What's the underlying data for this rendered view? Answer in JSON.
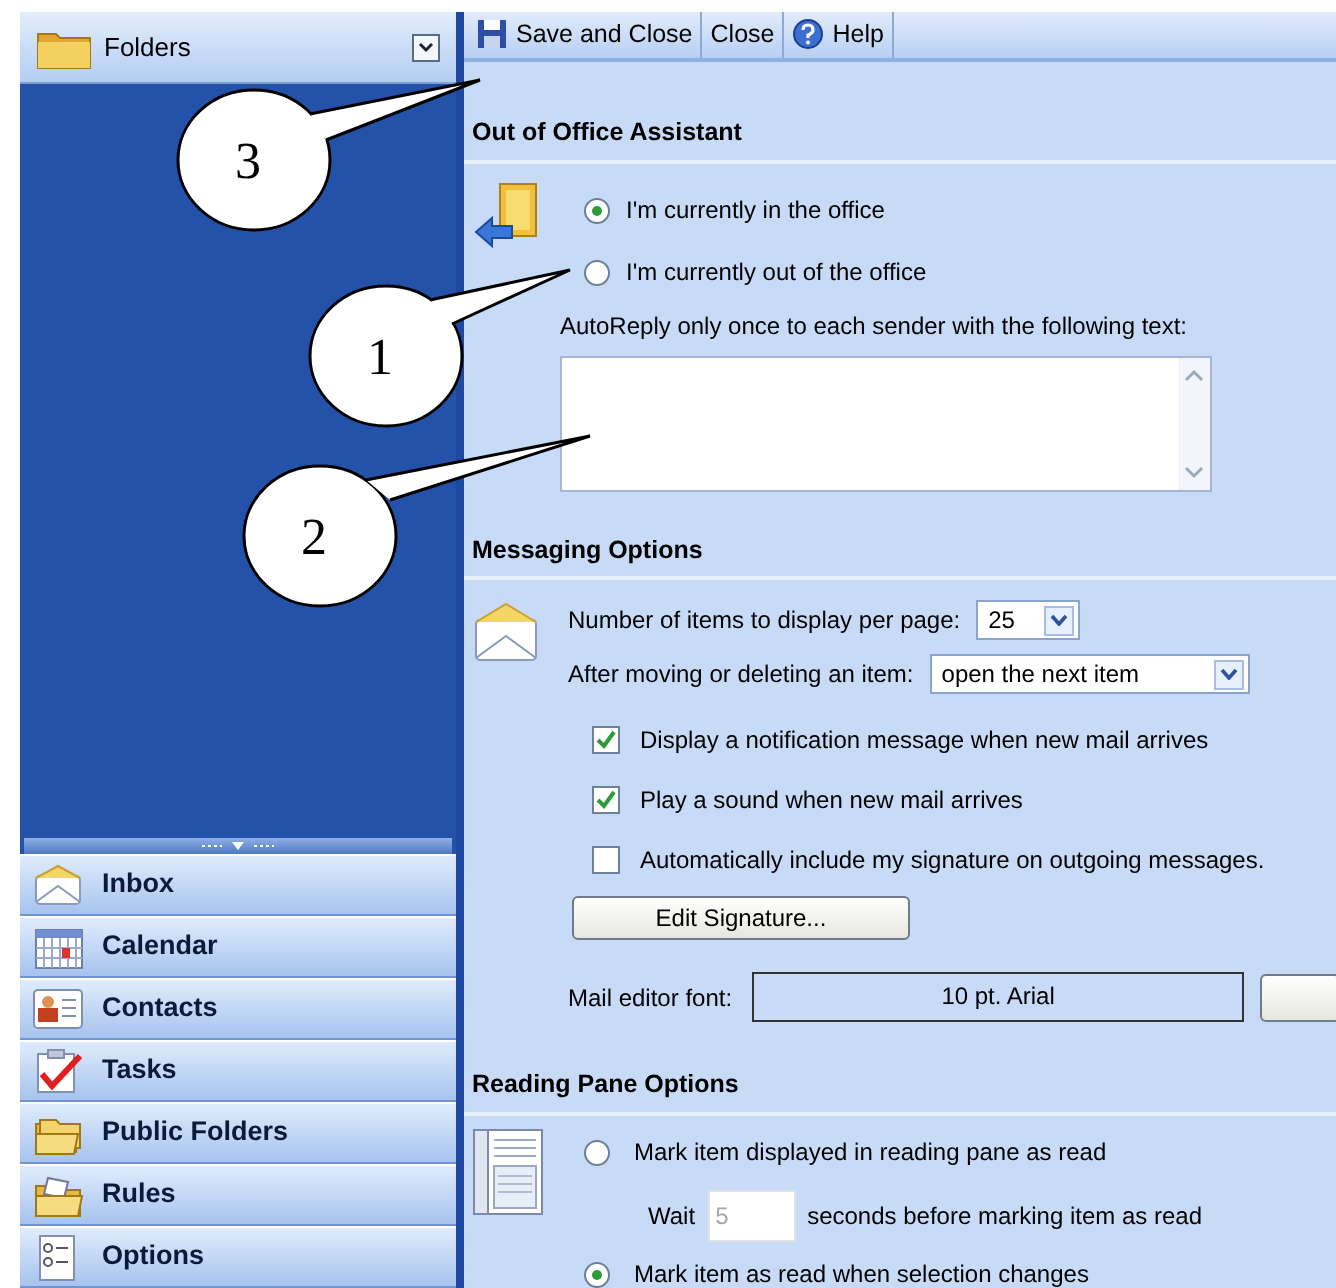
{
  "sidebar": {
    "header": "Folders",
    "nav_items": [
      {
        "label": "Inbox",
        "kind": "inbox"
      },
      {
        "label": "Calendar",
        "kind": "calendar"
      },
      {
        "label": "Contacts",
        "kind": "contacts"
      },
      {
        "label": "Tasks",
        "kind": "tasks"
      },
      {
        "label": "Public Folders",
        "kind": "folders"
      },
      {
        "label": "Rules",
        "kind": "rules"
      },
      {
        "label": "Options",
        "kind": "options"
      }
    ]
  },
  "toolbar": [
    {
      "label": "Save and Close",
      "kind": "save"
    },
    {
      "label": "Close",
      "kind": "plain"
    },
    {
      "label": "Help",
      "kind": "help"
    }
  ],
  "out_of_office": {
    "heading": "Out of Office Assistant",
    "options": [
      {
        "label": "I'm currently in the office",
        "selected": true
      },
      {
        "label": "I'm currently out of the office",
        "selected": false
      }
    ],
    "autoreply_label": "AutoReply only once to each sender with the following text:"
  },
  "messaging_options": {
    "heading": "Messaging Options",
    "items_per_page": {
      "label": "Number of items to display per page:",
      "value": "25"
    },
    "after_moving": {
      "label": "After moving or deleting an item:",
      "value": "open the next item"
    },
    "checkboxes": [
      {
        "label": "Display a notification message when new mail arrives",
        "checked": true
      },
      {
        "label": "Play a sound when new mail arrives",
        "checked": true
      },
      {
        "label": "Automatically include my signature on outgoing messages.",
        "checked": false
      }
    ],
    "edit_signature_button": "Edit Signature...",
    "mail_editor_font": {
      "label": "Mail editor font:",
      "value": "10 pt. Arial"
    }
  },
  "reading_pane_options": {
    "heading": "Reading Pane Options",
    "options": [
      {
        "label": "Mark item displayed in reading pane as read",
        "selected": false
      },
      {
        "label": "Mark item as read when selection changes",
        "selected": true
      }
    ],
    "wait": {
      "label_before": "Wait",
      "value": "5",
      "label_after": "seconds before marking item as read",
      "disabled": true
    }
  },
  "callouts": [
    {
      "label": "3"
    },
    {
      "label": "1"
    },
    {
      "label": "2"
    }
  ]
}
